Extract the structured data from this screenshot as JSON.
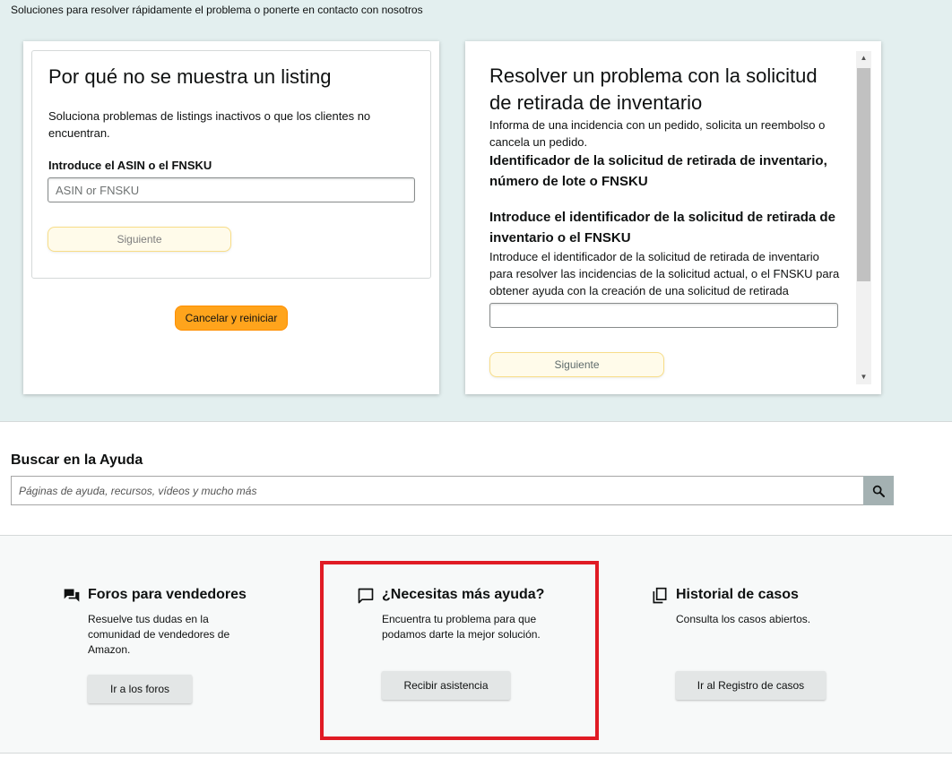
{
  "header": {
    "subtitle": "Soluciones para resolver rápidamente el problema o ponerte en contacto con nosotros"
  },
  "listing_card": {
    "title": "Por qué no se muestra un listing",
    "description": "Soluciona problemas de listings inactivos o que los clientes no encuentran.",
    "field_label": "Introduce el ASIN o el FNSKU",
    "input_placeholder": "ASIN or FNSKU",
    "input_value": "",
    "next_label": "Siguiente",
    "cancel_label": "Cancelar y reiniciar"
  },
  "removal_card": {
    "title": "Resolver un problema con la solicitud de retirada de inventario",
    "description": "Informa de una incidencia con un pedido, solicita un reembolso o cancela un pedido.",
    "identifier_heading": "Identificador de la solicitud de retirada de inventario, número de lote o FNSKU",
    "field_label": "Introduce el identificador de la solicitud de retirada de inventario o el FNSKU",
    "field_help": "Introduce el identificador de la solicitud de retirada de inventario para resolver las incidencias de la solicitud actual, o el FNSKU para obtener ayuda con la creación de una solicitud de retirada",
    "input_value": "",
    "next_label": "Siguiente"
  },
  "search": {
    "heading": "Buscar en la Ayuda",
    "placeholder": "Páginas de ayuda, recursos, vídeos y mucho más",
    "icon": "search-icon"
  },
  "help_columns": [
    {
      "icon": "forum-icon",
      "title": "Foros para vendedores",
      "description": "Resuelve tus dudas en la comunidad de vendedores de Amazon.",
      "button": "Ir a los foros"
    },
    {
      "icon": "chat-bubble-icon",
      "title": "¿Necesitas más ayuda?",
      "description": "Encuentra tu problema para que podamos darte la mejor solución.",
      "button": "Recibir asistencia"
    },
    {
      "icon": "copy-icon",
      "title": "Historial de casos",
      "description": "Consulta los casos abiertos.",
      "button": "Ir al Registro de casos"
    }
  ],
  "colors": {
    "top_background": "#e3efef",
    "primary_button": "#ffa41c",
    "secondary_button_bg": "#fffbea",
    "highlight": "#e01b24",
    "search_button": "#a4b1b2"
  }
}
